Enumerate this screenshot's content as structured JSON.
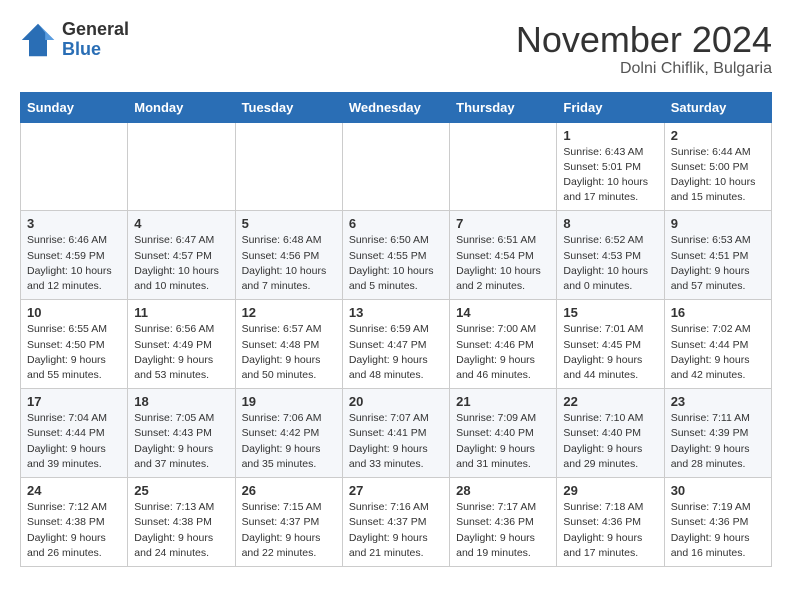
{
  "header": {
    "logo_general": "General",
    "logo_blue": "Blue",
    "month": "November 2024",
    "location": "Dolni Chiflik, Bulgaria"
  },
  "weekdays": [
    "Sunday",
    "Monday",
    "Tuesday",
    "Wednesday",
    "Thursday",
    "Friday",
    "Saturday"
  ],
  "weeks": [
    [
      {
        "day": "",
        "info": ""
      },
      {
        "day": "",
        "info": ""
      },
      {
        "day": "",
        "info": ""
      },
      {
        "day": "",
        "info": ""
      },
      {
        "day": "",
        "info": ""
      },
      {
        "day": "1",
        "info": "Sunrise: 6:43 AM\nSunset: 5:01 PM\nDaylight: 10 hours\nand 17 minutes."
      },
      {
        "day": "2",
        "info": "Sunrise: 6:44 AM\nSunset: 5:00 PM\nDaylight: 10 hours\nand 15 minutes."
      }
    ],
    [
      {
        "day": "3",
        "info": "Sunrise: 6:46 AM\nSunset: 4:59 PM\nDaylight: 10 hours\nand 12 minutes."
      },
      {
        "day": "4",
        "info": "Sunrise: 6:47 AM\nSunset: 4:57 PM\nDaylight: 10 hours\nand 10 minutes."
      },
      {
        "day": "5",
        "info": "Sunrise: 6:48 AM\nSunset: 4:56 PM\nDaylight: 10 hours\nand 7 minutes."
      },
      {
        "day": "6",
        "info": "Sunrise: 6:50 AM\nSunset: 4:55 PM\nDaylight: 10 hours\nand 5 minutes."
      },
      {
        "day": "7",
        "info": "Sunrise: 6:51 AM\nSunset: 4:54 PM\nDaylight: 10 hours\nand 2 minutes."
      },
      {
        "day": "8",
        "info": "Sunrise: 6:52 AM\nSunset: 4:53 PM\nDaylight: 10 hours\nand 0 minutes."
      },
      {
        "day": "9",
        "info": "Sunrise: 6:53 AM\nSunset: 4:51 PM\nDaylight: 9 hours\nand 57 minutes."
      }
    ],
    [
      {
        "day": "10",
        "info": "Sunrise: 6:55 AM\nSunset: 4:50 PM\nDaylight: 9 hours\nand 55 minutes."
      },
      {
        "day": "11",
        "info": "Sunrise: 6:56 AM\nSunset: 4:49 PM\nDaylight: 9 hours\nand 53 minutes."
      },
      {
        "day": "12",
        "info": "Sunrise: 6:57 AM\nSunset: 4:48 PM\nDaylight: 9 hours\nand 50 minutes."
      },
      {
        "day": "13",
        "info": "Sunrise: 6:59 AM\nSunset: 4:47 PM\nDaylight: 9 hours\nand 48 minutes."
      },
      {
        "day": "14",
        "info": "Sunrise: 7:00 AM\nSunset: 4:46 PM\nDaylight: 9 hours\nand 46 minutes."
      },
      {
        "day": "15",
        "info": "Sunrise: 7:01 AM\nSunset: 4:45 PM\nDaylight: 9 hours\nand 44 minutes."
      },
      {
        "day": "16",
        "info": "Sunrise: 7:02 AM\nSunset: 4:44 PM\nDaylight: 9 hours\nand 42 minutes."
      }
    ],
    [
      {
        "day": "17",
        "info": "Sunrise: 7:04 AM\nSunset: 4:44 PM\nDaylight: 9 hours\nand 39 minutes."
      },
      {
        "day": "18",
        "info": "Sunrise: 7:05 AM\nSunset: 4:43 PM\nDaylight: 9 hours\nand 37 minutes."
      },
      {
        "day": "19",
        "info": "Sunrise: 7:06 AM\nSunset: 4:42 PM\nDaylight: 9 hours\nand 35 minutes."
      },
      {
        "day": "20",
        "info": "Sunrise: 7:07 AM\nSunset: 4:41 PM\nDaylight: 9 hours\nand 33 minutes."
      },
      {
        "day": "21",
        "info": "Sunrise: 7:09 AM\nSunset: 4:40 PM\nDaylight: 9 hours\nand 31 minutes."
      },
      {
        "day": "22",
        "info": "Sunrise: 7:10 AM\nSunset: 4:40 PM\nDaylight: 9 hours\nand 29 minutes."
      },
      {
        "day": "23",
        "info": "Sunrise: 7:11 AM\nSunset: 4:39 PM\nDaylight: 9 hours\nand 28 minutes."
      }
    ],
    [
      {
        "day": "24",
        "info": "Sunrise: 7:12 AM\nSunset: 4:38 PM\nDaylight: 9 hours\nand 26 minutes."
      },
      {
        "day": "25",
        "info": "Sunrise: 7:13 AM\nSunset: 4:38 PM\nDaylight: 9 hours\nand 24 minutes."
      },
      {
        "day": "26",
        "info": "Sunrise: 7:15 AM\nSunset: 4:37 PM\nDaylight: 9 hours\nand 22 minutes."
      },
      {
        "day": "27",
        "info": "Sunrise: 7:16 AM\nSunset: 4:37 PM\nDaylight: 9 hours\nand 21 minutes."
      },
      {
        "day": "28",
        "info": "Sunrise: 7:17 AM\nSunset: 4:36 PM\nDaylight: 9 hours\nand 19 minutes."
      },
      {
        "day": "29",
        "info": "Sunrise: 7:18 AM\nSunset: 4:36 PM\nDaylight: 9 hours\nand 17 minutes."
      },
      {
        "day": "30",
        "info": "Sunrise: 7:19 AM\nSunset: 4:36 PM\nDaylight: 9 hours\nand 16 minutes."
      }
    ]
  ]
}
